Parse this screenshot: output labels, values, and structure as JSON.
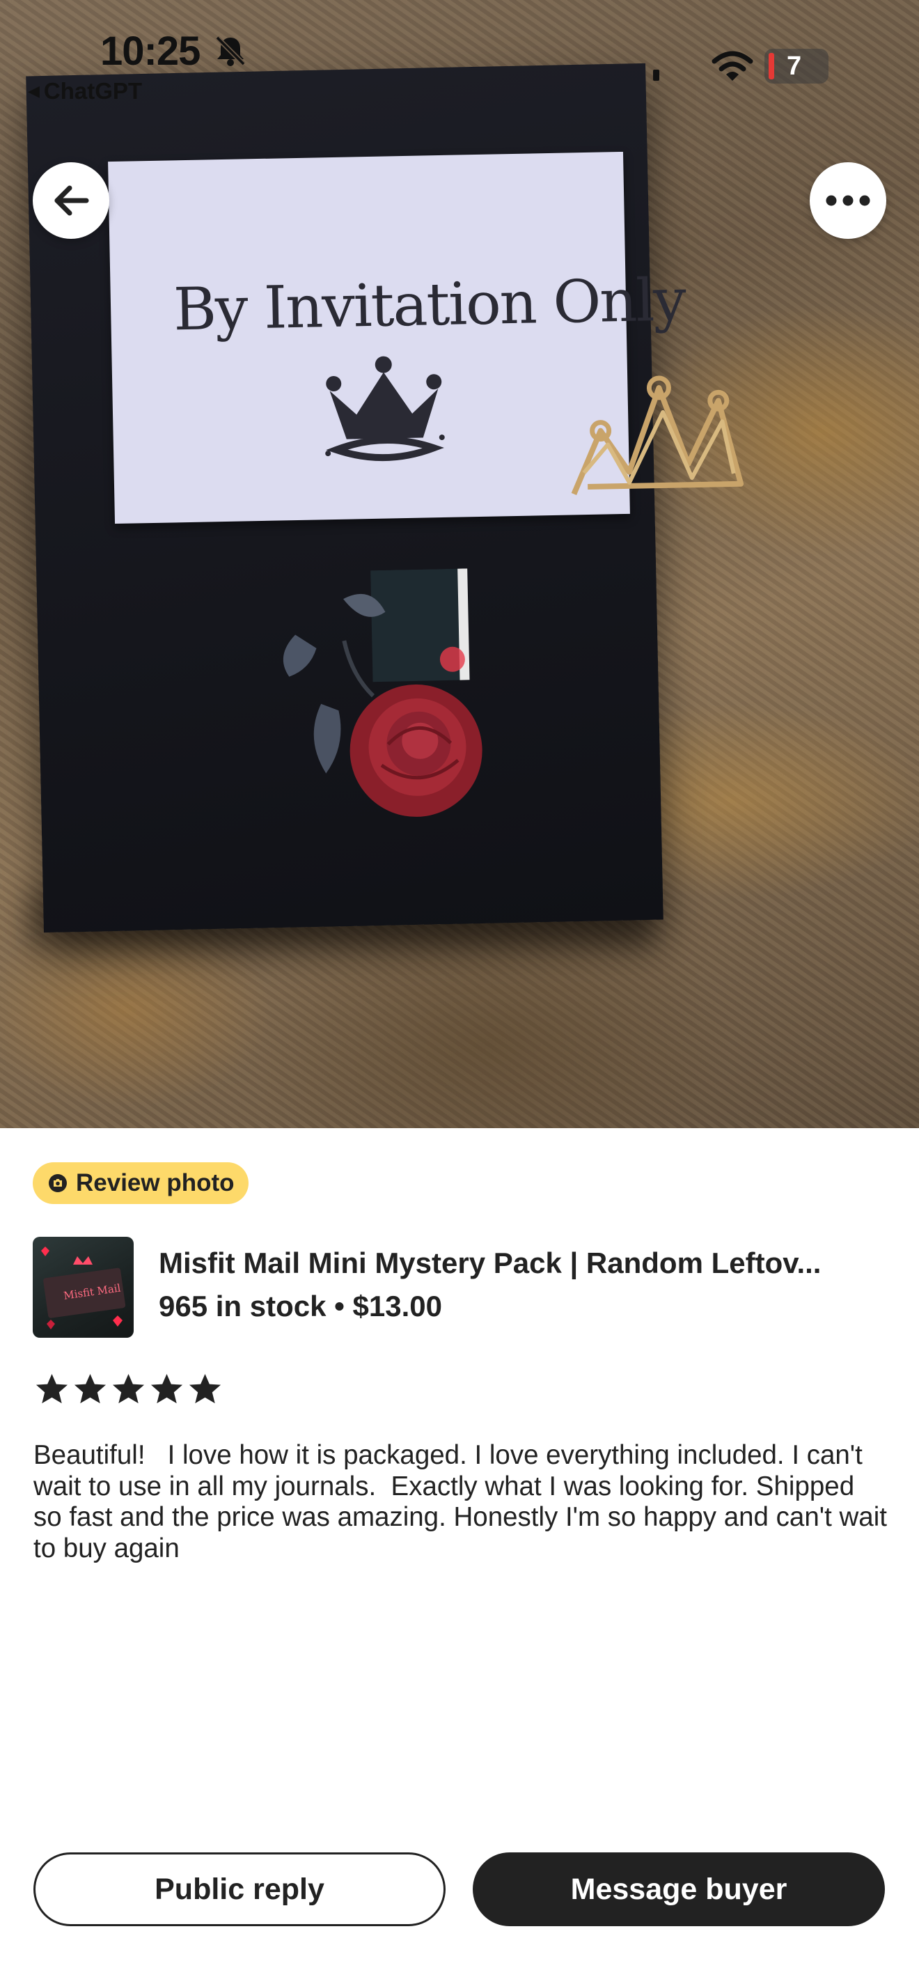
{
  "status_bar": {
    "time": "10:25",
    "back_app_label": "ChatGPT",
    "battery_level": "7",
    "icons": [
      "bell-slash-icon",
      "signal-icon",
      "wifi-icon",
      "battery-icon"
    ]
  },
  "photo": {
    "card_text": "By Invitation Only"
  },
  "nav": {
    "back_icon": "arrow-left-icon",
    "more_icon": "more-horizontal-icon"
  },
  "badge": {
    "label": "Review photo",
    "icon": "photo-badge-icon",
    "color": "#fdd96a"
  },
  "product": {
    "title": "Misfit Mail Mini Mystery Pack | Random Leftov...",
    "stock_price": "965 in stock • $13.00",
    "thumbnail_icon": "product-thumbnail"
  },
  "rating": {
    "stars": 5,
    "max_stars": 5
  },
  "review": {
    "text": "Beautiful!   I love how it is packaged. I love everything included. I can't wait to use in all my journals.  Exactly what I was looking for. Shipped so fast and the price was amazing. Honestly I'm so happy and can't wait to buy again"
  },
  "actions": {
    "public_reply": "Public reply",
    "message_buyer": "Message buyer"
  },
  "colors": {
    "primary_dark": "#222222",
    "badge_yellow": "#fdd96a",
    "battery_red": "#e53935"
  }
}
